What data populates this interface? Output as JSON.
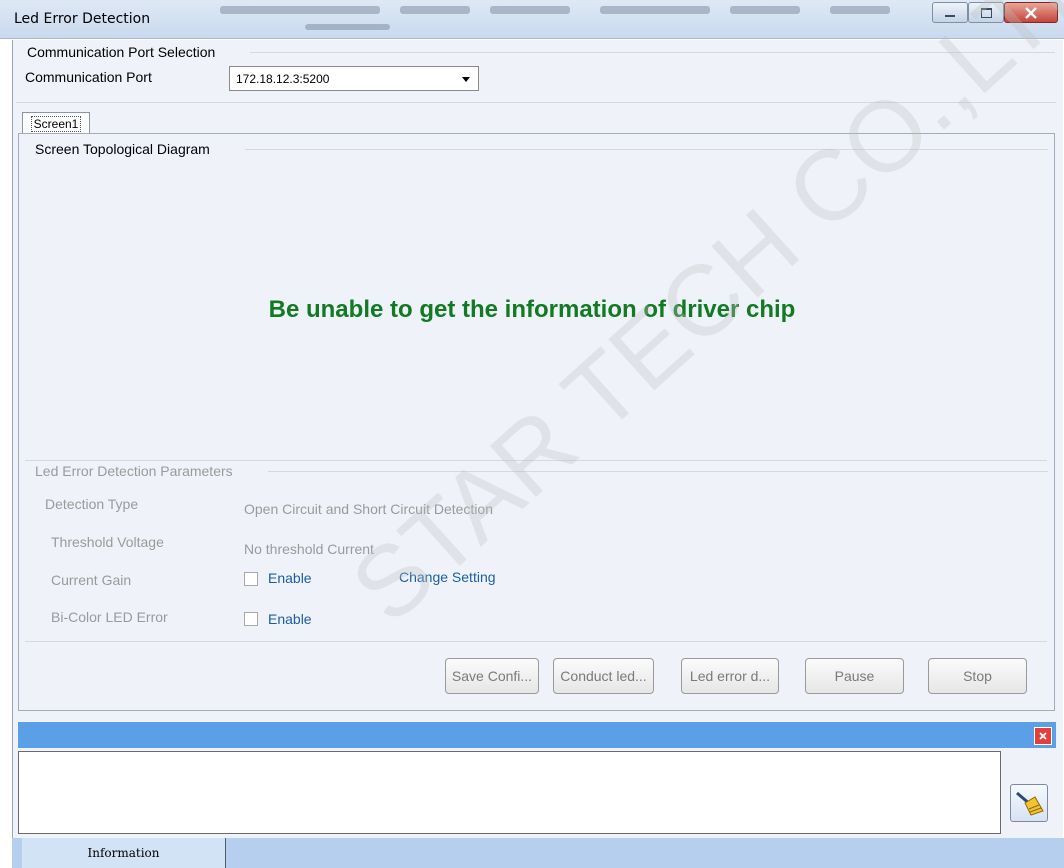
{
  "window": {
    "title": "Led Error Detection"
  },
  "port_group": {
    "title": "Communication Port Selection",
    "port_label": "Communication Port",
    "port_value": "172.18.12.3:5200"
  },
  "tabs": [
    {
      "label": "Screen1"
    }
  ],
  "diagram": {
    "title": "Screen Topological Diagram",
    "message": "Be unable to get the information of driver chip",
    "message_color": "#127a22"
  },
  "params": {
    "title": "Led Error Detection Parameters",
    "detection_type_label": "Detection Type",
    "detection_type_value": "Open Circuit and Short Circuit Detection",
    "threshold_label": "Threshold Voltage",
    "threshold_value": "No threshold Current",
    "current_gain_label": "Current Gain",
    "current_gain_enable": "Enable",
    "change_setting": "Change Setting",
    "bicolor_label": "Bi-Color LED Error",
    "bicolor_enable": "Enable"
  },
  "buttons": {
    "save": "Save Confi...",
    "conduct": "Conduct led...",
    "led_error": "Led error d...",
    "pause": "Pause",
    "stop": "Stop"
  },
  "info_panel": {
    "tab_label": "Information"
  },
  "watermark": "STAR TECH CO.,LTD.",
  "colors": {
    "info_bar": "#5b9fe6",
    "close_red": "#e0413b",
    "link_blue": "#1a5fa3"
  }
}
